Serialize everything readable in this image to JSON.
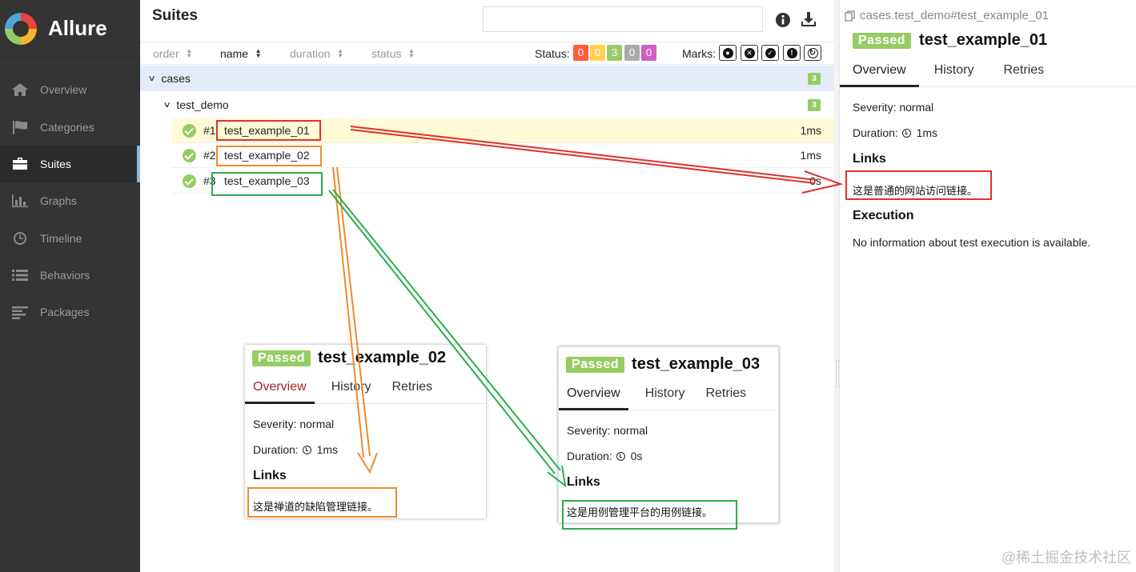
{
  "app": {
    "name": "Allure"
  },
  "sidebar": {
    "items": [
      {
        "label": "Overview",
        "icon": "home-icon"
      },
      {
        "label": "Categories",
        "icon": "flag-icon"
      },
      {
        "label": "Suites",
        "icon": "briefcase-icon",
        "active": true
      },
      {
        "label": "Graphs",
        "icon": "bar-chart-icon"
      },
      {
        "label": "Timeline",
        "icon": "clock-icon"
      },
      {
        "label": "Behaviors",
        "icon": "list-icon"
      },
      {
        "label": "Packages",
        "icon": "align-left-icon"
      }
    ]
  },
  "suites": {
    "title": "Suites",
    "search_value": "",
    "sort": {
      "order": "order",
      "name": "name",
      "duration": "duration",
      "status": "status"
    },
    "status_label": "Status:",
    "status_counts": [
      {
        "value": "0",
        "color": "#fd5a3e"
      },
      {
        "value": "0",
        "color": "#ffd050"
      },
      {
        "value": "3",
        "color": "#97cc64"
      },
      {
        "value": "0",
        "color": "#aaaaaa"
      },
      {
        "value": "0",
        "color": "#d35ebe"
      }
    ],
    "marks_label": "Marks:",
    "tree": {
      "root": {
        "label": "cases",
        "count": "3"
      },
      "child": {
        "label": "test_demo",
        "count": "3"
      },
      "cases": [
        {
          "num": "#1",
          "name": "test_example_01",
          "duration": "1ms",
          "status": "passed",
          "selected": true
        },
        {
          "num": "#2",
          "name": "test_example_02",
          "duration": "1ms",
          "status": "passed"
        },
        {
          "num": "#3",
          "name": "test_example_03",
          "duration": "0s",
          "status": "passed"
        }
      ]
    }
  },
  "detail": {
    "breadcrumb": "cases.test_demo#test_example_01",
    "status": "Passed",
    "title": "test_example_01",
    "tabs": [
      "Overview",
      "History",
      "Retries"
    ],
    "severity": "Severity: normal",
    "duration_label": "Duration:",
    "duration_value": "1ms",
    "links_heading": "Links",
    "link_text": "这是普通的网站访问链接。",
    "execution_heading": "Execution",
    "execution_text": "No information about test execution is available."
  },
  "card2": {
    "status": "Passed",
    "title": "test_example_02",
    "tabs": [
      "Overview",
      "History",
      "Retries"
    ],
    "severity": "Severity: normal",
    "duration_label": "Duration:",
    "duration_value": "1ms",
    "links_heading": "Links",
    "link_text": "这是禅道的缺陷管理链接。"
  },
  "card3": {
    "status": "Passed",
    "title": "test_example_03",
    "tabs": [
      "Overview",
      "History",
      "Retries"
    ],
    "severity": "Severity: normal",
    "duration_label": "Duration:",
    "duration_value": "0s",
    "links_heading": "Links",
    "link_text": "这是用例管理平台的用例链接。"
  },
  "watermark": "@稀土掘金技术社区",
  "colors": {
    "annotation_red": "#e03030",
    "annotation_orange": "#f08a2a",
    "annotation_green": "#2aae4a",
    "passed": "#97cc64",
    "sidebar_bg": "#343434"
  }
}
